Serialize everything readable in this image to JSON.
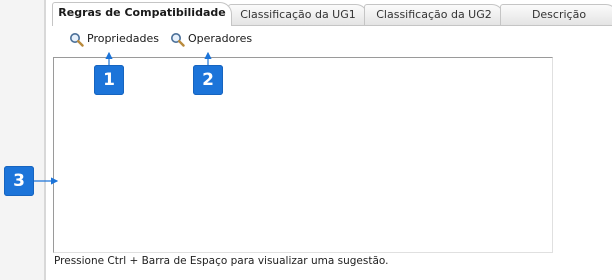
{
  "tabs": [
    {
      "label": "Regras de Compatibilidade",
      "active": true
    },
    {
      "label": "Classificação da UG1",
      "active": false
    },
    {
      "label": "Classificação da UG2",
      "active": false
    },
    {
      "label": "Descrição",
      "active": false
    }
  ],
  "toolbar": {
    "properties_label": "Propriedades",
    "properties_icon": "magnifier-icon",
    "operators_label": "Operadores",
    "operators_icon": "magnifier-icon"
  },
  "editor": {
    "value": ""
  },
  "hint": "Pressione Ctrl + Barra de Espaço para visualizar uma sugestão.",
  "callouts": [
    "1",
    "2",
    "3"
  ],
  "colors": {
    "callout_bg": "#1c74d9",
    "arrow": "#1c74d9"
  }
}
